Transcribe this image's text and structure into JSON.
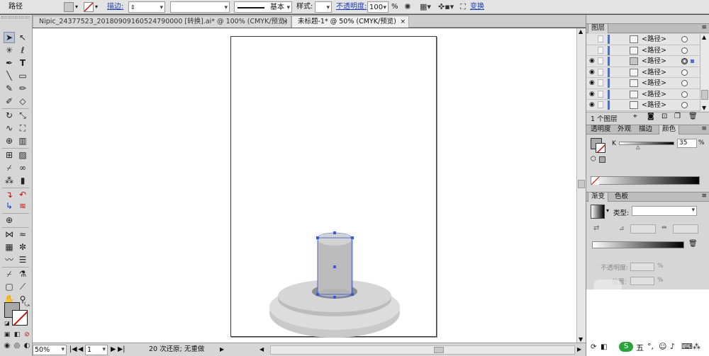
{
  "toolbar": {
    "object_type": "路径",
    "stroke_label": "描边:",
    "stroke_weight_value": "",
    "brush_label": "基本",
    "style_label": "样式:",
    "opacity_label": "不透明度:",
    "opacity_value": "100",
    "opacity_unit": "%",
    "transform_label": "变换"
  },
  "tabs": [
    {
      "label": "Nipic_24377523_20180909160524790000  [转换].ai* @ 100% (CMYK/预览)",
      "close": "×"
    },
    {
      "label": "未标题-1* @ 50% (CMYK/预览)",
      "close": "×"
    }
  ],
  "status": {
    "zoom": "50%",
    "artboard": "1",
    "history": "20 次还原; 无重做"
  },
  "layers_panel": {
    "title": "图层",
    "items": [
      "<路径>",
      "<路径>",
      "<路径>",
      "<路径>",
      "<路径>",
      "<路径>",
      "<路径>"
    ],
    "count": "1 个图层"
  },
  "color_panel": {
    "tabs": [
      "透明度",
      "外观",
      "描边",
      "颜色"
    ],
    "active_tab": "颜色",
    "channel": "K",
    "value": "35",
    "unit": "%"
  },
  "gradient_panel": {
    "tabs": [
      "渐变",
      "色板"
    ],
    "type_label": "类型:",
    "opacity_label": "不透明度:",
    "location_label": "位置:",
    "unit": "%"
  },
  "taskbar": {
    "ime_char": "五"
  },
  "colors": {
    "selection_blue": "#3a5bd9",
    "pedestal_gray": "#c8c8c8",
    "cylinder_gray": "#b8b8b8"
  }
}
